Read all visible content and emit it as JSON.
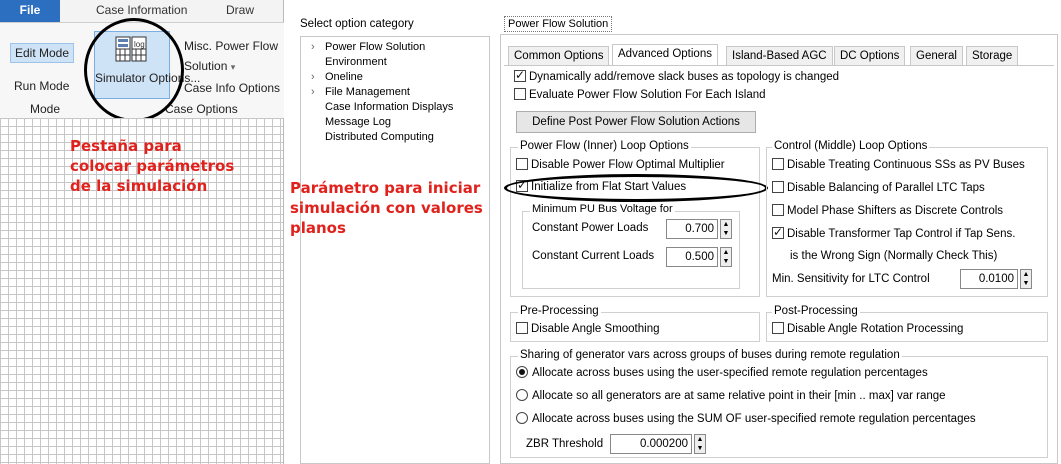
{
  "ribbon": {
    "tabs": [
      "File",
      "Case Information",
      "Draw"
    ],
    "edit_mode": "Edit Mode",
    "run_mode": "Run Mode",
    "mode_group": "Mode",
    "simulator_options": "Simulator Options...",
    "misc_power_flow": "Misc. Power Flow",
    "solution": "Solution",
    "case_info_options": "Case Info Options",
    "case_options_group": "Case Options"
  },
  "annotations": {
    "tab_note": "Pestaña para colocar parámetros de la simulación",
    "param_note": "Parámetro para iniciar simulación con valores planos"
  },
  "category": {
    "title": "Select option category",
    "items": [
      {
        "label": "Power Flow Solution",
        "expandable": true
      },
      {
        "label": "Environment",
        "expandable": false
      },
      {
        "label": "Oneline",
        "expandable": true
      },
      {
        "label": "File Management",
        "expandable": true
      },
      {
        "label": "Case Information Displays",
        "expandable": false
      },
      {
        "label": "Message Log",
        "expandable": false
      },
      {
        "label": "Distributed Computing",
        "expandable": false
      }
    ]
  },
  "panel": {
    "title": "Power Flow Solution",
    "tabs": [
      "Common Options",
      "Advanced Options",
      "Island-Based AGC",
      "DC Options",
      "General",
      "Storage"
    ],
    "active_tab": "Advanced Options",
    "top_checks": [
      {
        "label": "Dynamically add/remove slack buses as topology is changed",
        "checked": true
      },
      {
        "label": "Evaluate Power Flow Solution For Each Island",
        "checked": false
      }
    ],
    "post_actions_button": "Define Post Power Flow Solution Actions",
    "inner_loop": {
      "title": "Power Flow (Inner) Loop Options",
      "disable_optimal_multiplier": "Disable Power Flow Optimal Multiplier",
      "disable_optimal_multiplier_checked": false,
      "flat_start": "Initialize from Flat Start Values",
      "flat_start_checked": true,
      "min_voltage_label": "Minimum PU Bus Voltage for",
      "constant_power_label": "Constant Power Loads",
      "constant_power_value": "0.700",
      "constant_current_label": "Constant Current Loads",
      "constant_current_value": "0.500"
    },
    "control_loop": {
      "title": "Control (Middle) Loop Options",
      "checks": [
        {
          "label": "Disable Treating Continuous SSs as PV Buses",
          "checked": false
        },
        {
          "label": "Disable Balancing of Parallel LTC Taps",
          "checked": false
        },
        {
          "label": "Model Phase Shifters as Discrete Controls",
          "checked": false
        },
        {
          "label": "Disable Transformer Tap Control if Tap Sens.",
          "checked": true
        }
      ],
      "wrong_sign_note": "is the Wrong Sign (Normally Check This)",
      "min_sensitivity_label": "Min. Sensitivity for LTC Control",
      "min_sensitivity_value": "0.0100"
    },
    "pre_processing": {
      "title": "Pre-Processing",
      "check": "Disable Angle Smoothing",
      "checked": false
    },
    "post_processing": {
      "title": "Post-Processing",
      "check": "Disable Angle Rotation Processing",
      "checked": false
    },
    "sharing": {
      "title": "Sharing of generator vars across groups of buses during remote regulation",
      "options": [
        {
          "label": "Allocate across buses using the user-specified remote regulation percentages",
          "selected": true
        },
        {
          "label": "Allocate so all generators are at same relative point in their [min .. max] var range",
          "selected": false
        },
        {
          "label": "Allocate across buses using the SUM OF user-specified remote regulation percentages",
          "selected": false
        }
      ],
      "zbr_label": "ZBR Threshold",
      "zbr_value": "0.000200"
    }
  }
}
